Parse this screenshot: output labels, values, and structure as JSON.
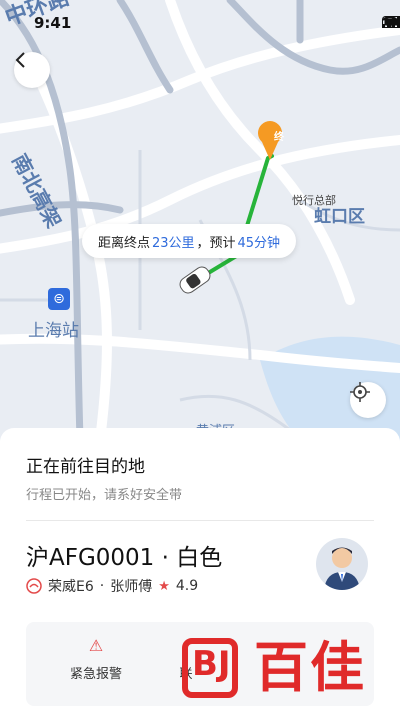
{
  "status_bar": {
    "time": "9:41"
  },
  "map": {
    "labels": {
      "ring_road": "中环路",
      "expressway": "南北高架",
      "district": "虹口区",
      "poi": "悦行总部",
      "station": "上海站",
      "bottom_area": "黄浦区"
    },
    "destination_marker": "终",
    "route_color": "#27b43a"
  },
  "trip_info": {
    "distance_label": "距离终点",
    "distance_value": "23公里",
    "separator": "，预计",
    "eta_value": "45分钟"
  },
  "trip": {
    "title": "正在前往目的地",
    "subtitle": "行程已开始，请系好安全带"
  },
  "vehicle": {
    "plate_and_color": "沪AFG0001 · 白色",
    "model": "荣威E6",
    "dot": "·",
    "driver": "张师傅",
    "rating": "4.9"
  },
  "actions": {
    "emergency_label": "紧急报警",
    "second_label": "联"
  },
  "watermark": {
    "logo_letters": "BJ",
    "text": "百佳"
  },
  "colors": {
    "accent": "#2f6bdc",
    "alarm": "#e34a4a",
    "brand": "#e02a2a"
  }
}
